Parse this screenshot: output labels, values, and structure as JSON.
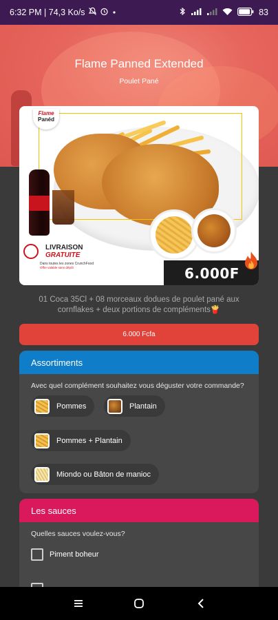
{
  "status_bar": {
    "time_speed": "6:32 PM | 74,3 Ko/s",
    "battery": "83"
  },
  "hero": {
    "title": "Flame Panned Extended",
    "subtitle": "Poulet Pané"
  },
  "promo_image": {
    "brand_line1": "Flame",
    "brand_line2": "Panéd",
    "delivery_line1": "LIVRAISON",
    "delivery_line2": "GRATUITE",
    "delivery_note": "Dans toutes les zones CrunchFood",
    "delivery_note2": "Offre valable sans dépôt",
    "price": "6.000F"
  },
  "description": "01 Coca 35Cl + 08 morceaux dodues de poulet pané aux cornflakes + deux portions de compléments🍟",
  "price_button": "6.000 Fcfa",
  "assortiments": {
    "title": "Assortiments",
    "question": "Avec quel complément souhaitez vous déguster votre commande?",
    "options": [
      {
        "label": "Pommes",
        "icon": "fries-thumbnail"
      },
      {
        "label": "Plantain",
        "icon": "plantain-thumbnail"
      },
      {
        "label": "Pommes + Plantain",
        "icon": "fries-thumbnail"
      },
      {
        "label": "Miondo ou Bâton de manioc",
        "icon": "cassava-thumbnail"
      }
    ]
  },
  "sauces": {
    "title": "Les sauces",
    "question": "Quelles sauces voulez-vous?",
    "options": [
      {
        "label": "Piment boheur"
      },
      {
        "label": ""
      }
    ]
  },
  "colors": {
    "status_bar": "#3d1a52",
    "hero": "#e6655c",
    "price_button": "#e1433b",
    "assortiments_header": "#0f7dc8",
    "sauces_header": "#d9195c",
    "background": "#3a3a3a"
  }
}
